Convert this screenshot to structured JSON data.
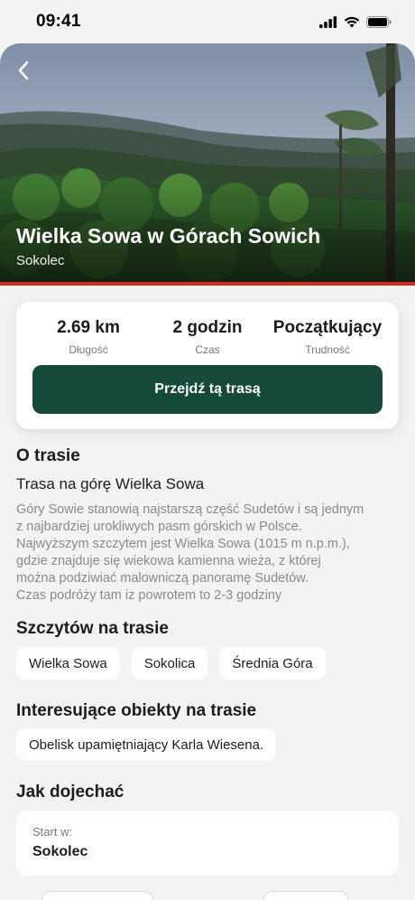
{
  "status_bar": {
    "time": "09:41"
  },
  "hero": {
    "title": "Wielka Sowa w Górach Sowich",
    "subtitle": "Sokolec"
  },
  "stats": [
    {
      "value": "2.69 km",
      "label": "Długość"
    },
    {
      "value": "2 godzin",
      "label": "Czas"
    },
    {
      "value": "Początkujący",
      "label": "Trudność"
    }
  ],
  "go_button_label": "Przejdź tą trasą",
  "about": {
    "title": "O trasie",
    "route_name": "Trasa na górę Wielka Sowa",
    "description_lines": [
      "Góry Sowie stanowią najstarszą część Sudetów i są jednym",
      "z najbardziej urokliwych pasm górskich w Polsce.",
      "Najwyższym szczytem jest Wielka Sowa (1015 m n.p.m.),",
      "gdzie znajduje się wiekowa kamienna wieża, z której",
      "można podziwiać malowniczą panoramę Sudetów.",
      "Czas podróży tam iz powrotem to 2-3 godziny"
    ]
  },
  "peaks": {
    "title": "Szczytów na trasie",
    "items": [
      "Wielka Sowa",
      "Sokolica",
      "Średnia Góra"
    ]
  },
  "objects": {
    "title": "Interesujące obiekty na trasie",
    "items": [
      "Obelisk upamiętniający Karla Wiesena."
    ]
  },
  "directions": {
    "title": "Jak dojechać",
    "start_label": "Start w:",
    "start_value": "Sokolec"
  },
  "colors": {
    "primary": "#154a3a",
    "accent_line": "#d42a1e",
    "background": "#f1f4f1"
  }
}
